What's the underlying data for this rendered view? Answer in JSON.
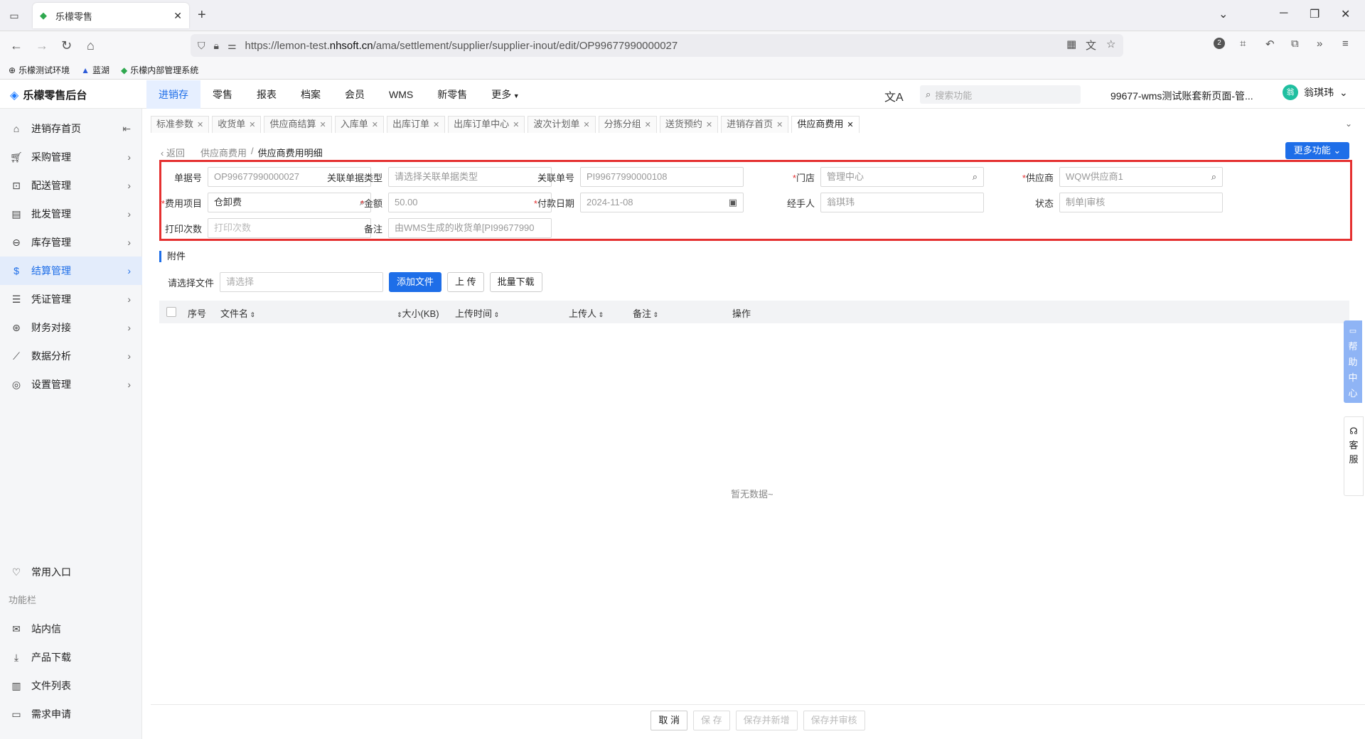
{
  "browser": {
    "tab_title": "乐檬零售",
    "url_prefix": "https://lemon-test.",
    "url_domain": "nhsoft.cn",
    "url_path": "/ama/settlement/supplier/supplier-inout/edit/OP99677990000027",
    "bookmarks": [
      "乐檬测试环境",
      "蓝湖",
      "乐檬内部管理系统"
    ],
    "badge": "2"
  },
  "app": {
    "logo": "乐檬零售后台",
    "nav": [
      "进销存",
      "零售",
      "报表",
      "档案",
      "会员",
      "WMS",
      "新零售",
      "更多"
    ],
    "search_placeholder": "搜索功能",
    "store": "99677-wms测试账套新页面-管...",
    "user": "翁琪玮",
    "avatar": "翁"
  },
  "sidebar": {
    "items": [
      {
        "label": "进销存首页",
        "icon": "home-icon"
      },
      {
        "label": "采购管理",
        "icon": "cart-icon"
      },
      {
        "label": "配送管理",
        "icon": "delivery-icon"
      },
      {
        "label": "批发管理",
        "icon": "wholesale-icon"
      },
      {
        "label": "库存管理",
        "icon": "inventory-icon"
      },
      {
        "label": "结算管理",
        "icon": "settlement-icon"
      },
      {
        "label": "凭证管理",
        "icon": "voucher-icon"
      },
      {
        "label": "财务对接",
        "icon": "finance-icon"
      },
      {
        "label": "数据分析",
        "icon": "chart-icon"
      },
      {
        "label": "设置管理",
        "icon": "settings-icon"
      }
    ],
    "favorites": "常用入口",
    "group_title": "功能栏",
    "func_items": [
      "站内信",
      "产品下载",
      "文件列表",
      "需求申请"
    ]
  },
  "tabs": [
    "标准参数",
    "收货单",
    "供应商结算",
    "入库单",
    "出库订单",
    "出库订单中心",
    "波次计划单",
    "分拣分组",
    "送货预约",
    "进销存首页",
    "供应商费用"
  ],
  "breadcrumb": {
    "back": "返回",
    "parent": "供应商费用",
    "current": "供应商费用明细"
  },
  "more_functions": "更多功能",
  "form": {
    "doc_no": {
      "label": "单据号",
      "value": "OP99677990000027"
    },
    "link_type": {
      "label": "关联单据类型",
      "value": "请选择关联单据类型"
    },
    "link_no": {
      "label": "关联单号",
      "value": "PI99677990000108"
    },
    "store": {
      "label": "门店",
      "value": "管理中心"
    },
    "supplier": {
      "label": "供应商",
      "value": "WQW供应商1"
    },
    "fee_item": {
      "label": "费用项目",
      "value": "仓卸费"
    },
    "amount": {
      "label": "金额",
      "value": "50.00"
    },
    "pay_date": {
      "label": "付款日期",
      "value": "2024-11-08"
    },
    "handler": {
      "label": "经手人",
      "value": "翁琪玮"
    },
    "status": {
      "label": "状态",
      "value": "制单|审核"
    },
    "print_count": {
      "label": "打印次数",
      "value": "打印次数"
    },
    "remark": {
      "label": "备注",
      "value": "由WMS生成的收货单[PI99677990"
    }
  },
  "attachments": {
    "title": "附件",
    "select_label": "请选择文件",
    "select_placeholder": "请选择",
    "add_file": "添加文件",
    "upload": "上 传",
    "batch_download": "批量下载",
    "columns": [
      "序号",
      "文件名",
      "大小(KB)",
      "上传时间",
      "上传人",
      "备注",
      "操作"
    ],
    "empty": "暂无数据~"
  },
  "footer": {
    "cancel": "取 消",
    "save": "保 存",
    "save_new": "保存并新增",
    "save_audit": "保存并审核"
  },
  "help": "帮助中心",
  "kefu": "客服"
}
